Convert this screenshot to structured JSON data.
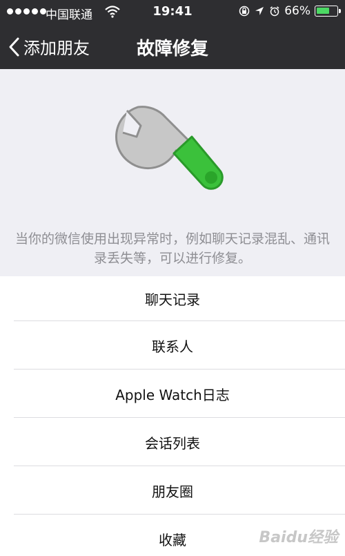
{
  "status": {
    "carrier": "中国联通",
    "time": "19:41",
    "battery_pct": "66%",
    "battery_level": 0.66,
    "battery_color": "#4cd964"
  },
  "nav": {
    "back_label": "添加朋友",
    "title": "故障修复"
  },
  "hero": {
    "icon": "wrench-icon",
    "description": "当你的微信使用出现异常时，例如聊天记录混乱、通讯录丢失等，可以进行修复。",
    "accent": "#3bc13b"
  },
  "list": {
    "items": [
      {
        "label": "聊天记录"
      },
      {
        "label": "联系人"
      },
      {
        "label": "Apple Watch日志"
      },
      {
        "label": "会话列表"
      },
      {
        "label": "朋友圈"
      },
      {
        "label": "收藏"
      }
    ]
  },
  "watermark": "Baidu经验"
}
